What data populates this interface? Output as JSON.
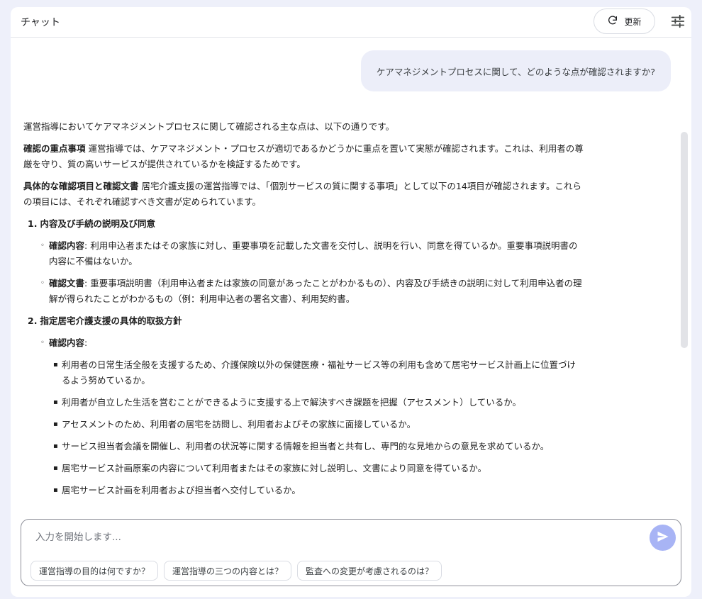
{
  "header": {
    "title": "チャット",
    "refresh_label": "更新",
    "refresh_icon": "refresh-icon",
    "settings_icon": "tune-icon"
  },
  "user_message": "ケアマネジメントプロセスに関して、どのような点が確認されますか?",
  "answer": {
    "intro": "運営指導においてケアマネジメントプロセスに関して確認される主な点は、以下の通りです。",
    "focus": {
      "heading": "確認の重点事項",
      "text": " 運営指導では、ケアマネジメント・プロセスが適切であるかどうかに重点を置いて実態が確認されます。これは、利用者の尊厳を守り、質の高いサービスが提供されているかを検証するためです。"
    },
    "specific": {
      "heading": "具体的な確認項目と確認文書",
      "text": " 居宅介護支援の運営指導では、「個別サービスの質に関する事項」として以下の14項目が確認されます。これらの項目には、それぞれ確認すべき文書が定められています。"
    },
    "item1": {
      "number": "1.",
      "title": "内容及び手続の説明及び同意",
      "content_label": "確認内容",
      "content_text": ": 利用申込者またはその家族に対し、重要事項を記載した文書を交付し、説明を行い、同意を得ているか。重要事項説明書の内容に不備はないか。",
      "doc_label": "確認文書",
      "doc_text": ": 重要事項説明書（利用申込者または家族の同意があったことがわかるもの）、内容及び手続きの説明に対して利用申込者の理解が得られたことがわかるもの（例：利用申込者の署名文書）、利用契約書。"
    },
    "item2": {
      "number": "2.",
      "title": "指定居宅介護支援の具体的取扱方針",
      "content_label": "確認内容",
      "content_text": ":",
      "bullets": [
        "利用者の日常生活全般を支援するため、介護保険以外の保健医療・福祉サービス等の利用も含めて居宅サービス計画上に位置づけるよう努めているか。",
        "利用者が自立した生活を営むことができるように支援する上で解決すべき課題を把握（アセスメント）しているか。",
        "アセスメントのため、利用者の居宅を訪問し、利用者およびその家族に面接しているか。",
        "サービス担当者会議を開催し、利用者の状況等に関する情報を担当者と共有し、専門的な見地からの意見を求めているか。",
        "居宅サービス計画原案の内容について利用者またはその家族に対し説明し、文書により同意を得ているか。",
        "居宅サービス計画を利用者および担当者へ交付しているか。"
      ]
    }
  },
  "markers": {
    "sub": "◦",
    "bullet": "▪"
  },
  "input": {
    "placeholder": "入力を開始します...",
    "value": "",
    "send_icon": "send-icon"
  },
  "suggestions": [
    "運営指導の目的は何ですか？",
    "運営指導の三つの内容とは？",
    "監査への変更が考慮されるのは？"
  ],
  "colors": {
    "background": "#eef0fa",
    "user_bubble": "#eceef9",
    "send_button": "#a8b4f5"
  }
}
